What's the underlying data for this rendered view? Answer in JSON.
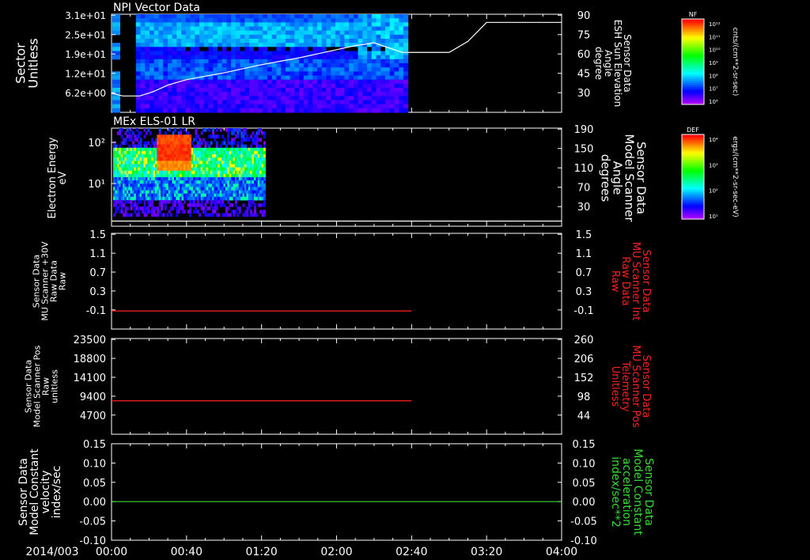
{
  "time_axis": {
    "date_label": "2014/003",
    "tick_labels": [
      "00:00",
      "00:40",
      "01:20",
      "02:00",
      "02:40",
      "03:20",
      "04:00"
    ]
  },
  "colorbars": [
    {
      "tag": "NF",
      "unit": "cnts/(cm**2-sr-sec)",
      "labels": [
        "10¹²",
        "10¹¹",
        "10¹⁰",
        "10⁹",
        "10⁸",
        "10⁷",
        "10⁶"
      ]
    },
    {
      "tag": "DEF",
      "unit": "ergs/(cm**2-sr-sec-eV)",
      "labels": [
        "10⁴",
        "10³",
        "10²",
        "10¹"
      ]
    }
  ],
  "chart_data": [
    {
      "type": "heatmap",
      "title": "NPI Vector Data",
      "ylabel": [
        "Sector",
        "Unitless"
      ],
      "ytick_labels": [
        "3.1e+01",
        "2.5e+01",
        "1.9e+01",
        "1.2e+01",
        "6.2e+00"
      ],
      "y2label": [
        "Sensor Data",
        "ESH Sun Elevation",
        "Angle",
        "degree"
      ],
      "y2tick_labels": [
        "90",
        "75",
        "60",
        "45",
        "30"
      ],
      "y2lim": [
        18,
        90
      ],
      "data_xrange": [
        "00:00",
        "02:38"
      ],
      "overlay_line": {
        "x": [
          "00:00",
          "00:06",
          "00:15",
          "00:22",
          "00:30",
          "00:40",
          "01:00",
          "01:20",
          "01:40",
          "02:00",
          "02:10",
          "02:20",
          "02:35",
          "02:50",
          "03:00",
          "03:10",
          "03:20",
          "04:00"
        ],
        "y": [
          32,
          30,
          30,
          33,
          38,
          42,
          47,
          53,
          58,
          64,
          67,
          69,
          62,
          62,
          62,
          70,
          84,
          84
        ]
      }
    },
    {
      "type": "heatmap",
      "title": "MEx ELS-01 LR",
      "ylabel": [
        "Electron Energy",
        "eV"
      ],
      "ytick_labels": [
        "10²",
        "10¹"
      ],
      "y2label": [
        "Sensor Data",
        "Model Scanner",
        "Angle",
        "degrees"
      ],
      "y2tick_labels": [
        "190",
        "150",
        "110",
        "70",
        "30"
      ],
      "y2lim": [
        0,
        190
      ],
      "data_xrange": [
        "00:00",
        "01:22"
      ],
      "overlay_line": {
        "x": [
          "00:00",
          "04:00"
        ],
        "y": [
          10,
          10
        ]
      }
    },
    {
      "type": "line",
      "ylabel": [
        "Sensor Data",
        "MU Scanner +30V",
        "Raw Data",
        "Raw"
      ],
      "ytick_labels": [
        "1.5",
        "1.1",
        "0.7",
        "0.3",
        "-0.1"
      ],
      "ylim": [
        -0.35,
        1.5
      ],
      "y2label": [
        "Sensor Data",
        "MU Scanner Int",
        "Raw Data",
        "Raw"
      ],
      "y2tick_labels": [
        "1.5",
        "1.1",
        "0.7",
        "0.3",
        "-0.1"
      ],
      "series": [
        {
          "color": "#ff2020",
          "x": [
            "00:00",
            "02:40"
          ],
          "y": [
            0,
            0
          ]
        }
      ]
    },
    {
      "type": "line",
      "ylabel": [
        "Sensor Data",
        "Model Scanner Pos",
        "Raw",
        "unitless"
      ],
      "ytick_labels": [
        "23500",
        "18800",
        "14100",
        "9400",
        "4700"
      ],
      "ylim": [
        0,
        23500
      ],
      "y2label": [
        "Sensor Data",
        "MU Scanner Pos",
        "Telemetry",
        "Unitless"
      ],
      "y2tick_labels": [
        "260",
        "206",
        "152",
        "98",
        "44"
      ],
      "series": [
        {
          "color": "#ff2020",
          "x": [
            "00:00",
            "02:40"
          ],
          "y": [
            8200,
            8200
          ]
        }
      ]
    },
    {
      "type": "line",
      "ylabel": [
        "Sensor Data",
        "Model Constant",
        "velocity",
        "index/sec"
      ],
      "ytick_labels": [
        "0.15",
        "0.10",
        "0.05",
        "0.00",
        "-0.05",
        "-0.10"
      ],
      "ylim": [
        -0.1,
        0.15
      ],
      "y2label": [
        "Sensor Data",
        "Model Constant",
        "acceleration",
        "index/sec**2"
      ],
      "y2tick_labels": [
        "0.15",
        "0.10",
        "0.05",
        "0.00",
        "-0.05",
        "-0.10"
      ],
      "series": [
        {
          "color": "#33dd33",
          "x": [
            "00:00",
            "04:00"
          ],
          "y": [
            0,
            0
          ]
        }
      ]
    }
  ]
}
